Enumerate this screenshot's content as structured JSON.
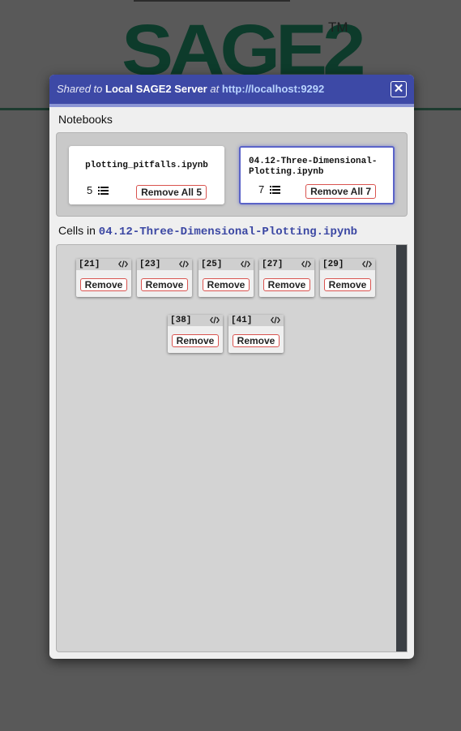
{
  "background": {
    "logo_text": "SAGE2",
    "trademark": "TM"
  },
  "dialog": {
    "header": {
      "shared_to": "Shared to",
      "server_name": "Local SAGE2 Server",
      "at": "at",
      "url": "http://localhost:9292",
      "close_glyph": "✕"
    },
    "notebooks_label": "Notebooks",
    "notebooks": [
      {
        "name": "plotting_pitfalls.ipynb",
        "count": "5",
        "remove_label": "Remove All 5",
        "selected": false
      },
      {
        "name": "04.12-Three-Dimensional-Plotting.ipynb",
        "count": "7",
        "remove_label": "Remove All 7",
        "selected": true
      }
    ],
    "cells_label_prefix": "Cells in",
    "cells_notebook": "04.12-Three-Dimensional-Plotting.ipynb",
    "cells": [
      {
        "label": "[21]",
        "remove_label": "Remove"
      },
      {
        "label": "[23]",
        "remove_label": "Remove"
      },
      {
        "label": "[25]",
        "remove_label": "Remove"
      },
      {
        "label": "[27]",
        "remove_label": "Remove"
      },
      {
        "label": "[29]",
        "remove_label": "Remove"
      },
      {
        "label": "[38]",
        "remove_label": "Remove"
      },
      {
        "label": "[41]",
        "remove_label": "Remove"
      }
    ]
  },
  "colors": {
    "header": "#3d49a6",
    "accent_border": "#5a63c8",
    "remove_border": "#d9534f"
  },
  "icons": {
    "close": "close-icon",
    "list": "list-icon",
    "code": "code-icon"
  }
}
